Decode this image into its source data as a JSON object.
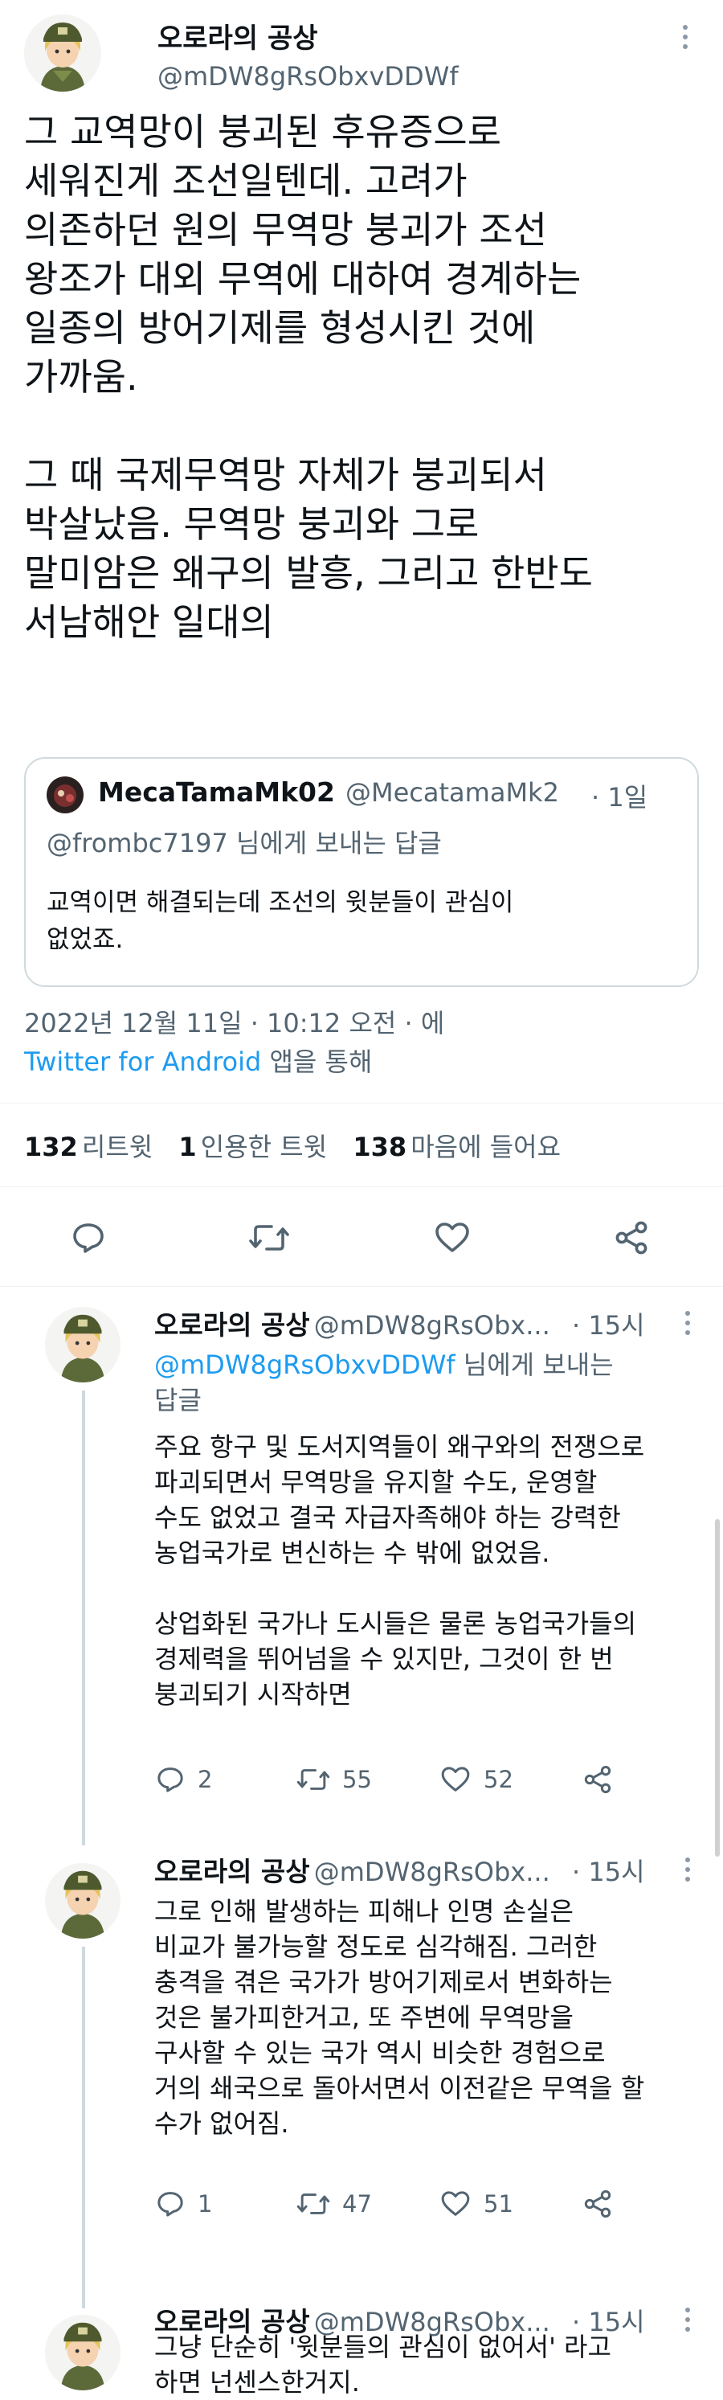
{
  "main_tweet": {
    "author_name": "오로라의 공상",
    "handle": "@mDW8gRsObxvDDWf",
    "more": "·",
    "text": "그 교역망이 붕괴된 후유증으로\n세워진게 조선일텐데. 고려가\n의존하던 원의 무역망 붕괴가 조선\n왕조가 대외 무역에 대하여 경계하는\n일종의 방어기제를 형성시킨 것에\n가까움.\n\n그 때 국제무역망 자체가 붕괴되서\n박살났음. 무역망 붕괴와 그로\n말미암은 왜구의 발흥, 그리고 한반도\n서남해안 일대의",
    "quote": {
      "author_name": "MecaTamaMk02",
      "handle": "@MecatamaMk2",
      "time": "· 1일",
      "reply_to_handle": "@frombc7197",
      "reply_to_suffix": " 님에게 보내는 답글",
      "text": "교역이면 해결되는데 조선의 윗분들이 관심이\n없었죠."
    },
    "timestamp": "2022년 12월 11일 · 10:12 오전 · 에",
    "source": "Twitter for Android",
    "source_suffix": " 앱을 통해",
    "stats": {
      "retweets": "132",
      "retweets_label": "리트윗",
      "quotes": "1",
      "quotes_label": "인용한 트윗",
      "likes": "138",
      "likes_label": "마음에 들어요"
    }
  },
  "replies": [
    {
      "author_name": "오로라의 공상",
      "handle": "@mDW8gRsObx...",
      "time": "· 15시",
      "reply_to_handle": "@mDW8gRsObxvDDWf",
      "reply_to_suffix": " 님에게 보내는",
      "reply_to_line2": "답글",
      "text": "주요 항구 및 도서지역들이 왜구와의 전쟁으로\n파괴되면서 무역망을 유지할 수도, 운영할\n수도 없었고 결국 자급자족해야 하는 강력한\n농업국가로 변신하는 수 밖에 없었음.\n\n상업화된 국가나 도시들은 물론 농업국가들의\n경제력을 뛰어넘을 수 있지만, 그것이 한 번\n붕괴되기 시작하면",
      "replies_count": "2",
      "retweets_count": "55",
      "likes_count": "52"
    },
    {
      "author_name": "오로라의 공상",
      "handle": "@mDW8gRsObx...",
      "time": "· 15시",
      "text": "그로 인해 발생하는 피해나 인명 손실은\n비교가 불가능할 정도로 심각해짐. 그러한\n충격을 겪은 국가가 방어기제로서 변화하는\n것은 불가피한거고, 또 주변에 무역망을\n구사할 수 있는 국가 역시 비슷한 경험으로\n거의 쇄국으로 돌아서면서 이전같은 무역을 할\n수가 없어짐.",
      "replies_count": "1",
      "retweets_count": "47",
      "likes_count": "51"
    },
    {
      "author_name": "오로라의 공상",
      "handle": "@mDW8gRsObx...",
      "time": "· 15시",
      "text": "그냥 단순히 '윗분들의 관심이 없어서' 라고\n하면 넌센스한거지."
    }
  ],
  "icons": {
    "more": "more-dots-icon",
    "reply": "reply-icon",
    "retweet": "retweet-icon",
    "like": "heart-icon",
    "share": "share-icon"
  },
  "colors": {
    "accent": "#1d9bf0",
    "secondary_text": "#536471",
    "border": "#cfd9de"
  }
}
